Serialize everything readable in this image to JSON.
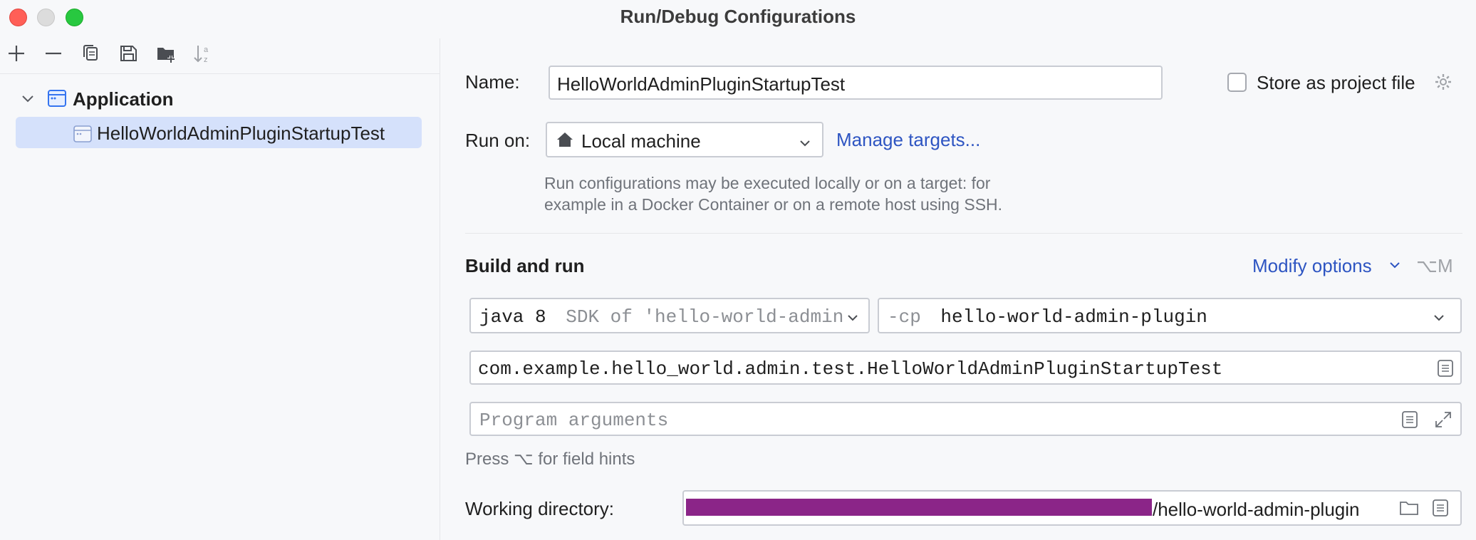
{
  "window": {
    "title": "Run/Debug Configurations"
  },
  "toolbar": {
    "icons": [
      "add-icon",
      "remove-icon",
      "copy-icon",
      "save-icon",
      "new-folder-icon",
      "sort-alpha-icon"
    ]
  },
  "tree": {
    "group_label": "Application",
    "items": [
      {
        "label": "HelloWorldAdminPluginStartupTest",
        "selected": true
      }
    ]
  },
  "form": {
    "name_label": "Name:",
    "name_value": "HelloWorldAdminPluginStartupTest",
    "store_as_project_label": "Store as project file",
    "store_as_project_checked": false,
    "run_on_label": "Run on:",
    "run_on_value": "Local machine",
    "manage_targets_link": "Manage targets...",
    "run_on_hint_line1": "Run configurations may be executed locally or on a target: for",
    "run_on_hint_line2": "example in a Docker Container or on a remote host using SSH.",
    "build_and_run_title": "Build and run",
    "modify_options_label": "Modify options",
    "modify_options_shortcut": "⌥M",
    "jdk_value": "java 8",
    "jdk_detail": "SDK of 'hello-world-admin",
    "cp_prefix": "-cp",
    "cp_value": "hello-world-admin-plugin",
    "main_class_value": "com.example.hello_world.admin.test.HelloWorldAdminPluginStartupTest",
    "program_args_placeholder": "Program arguments",
    "field_hints_text": "Press ⌥ for field hints",
    "working_dir_label": "Working directory:",
    "working_dir_value": "/hello-world-admin-plugin"
  },
  "colors": {
    "accent": "#2e55c2",
    "selection": "#d5e1fb",
    "redaction": "#8b2588"
  }
}
